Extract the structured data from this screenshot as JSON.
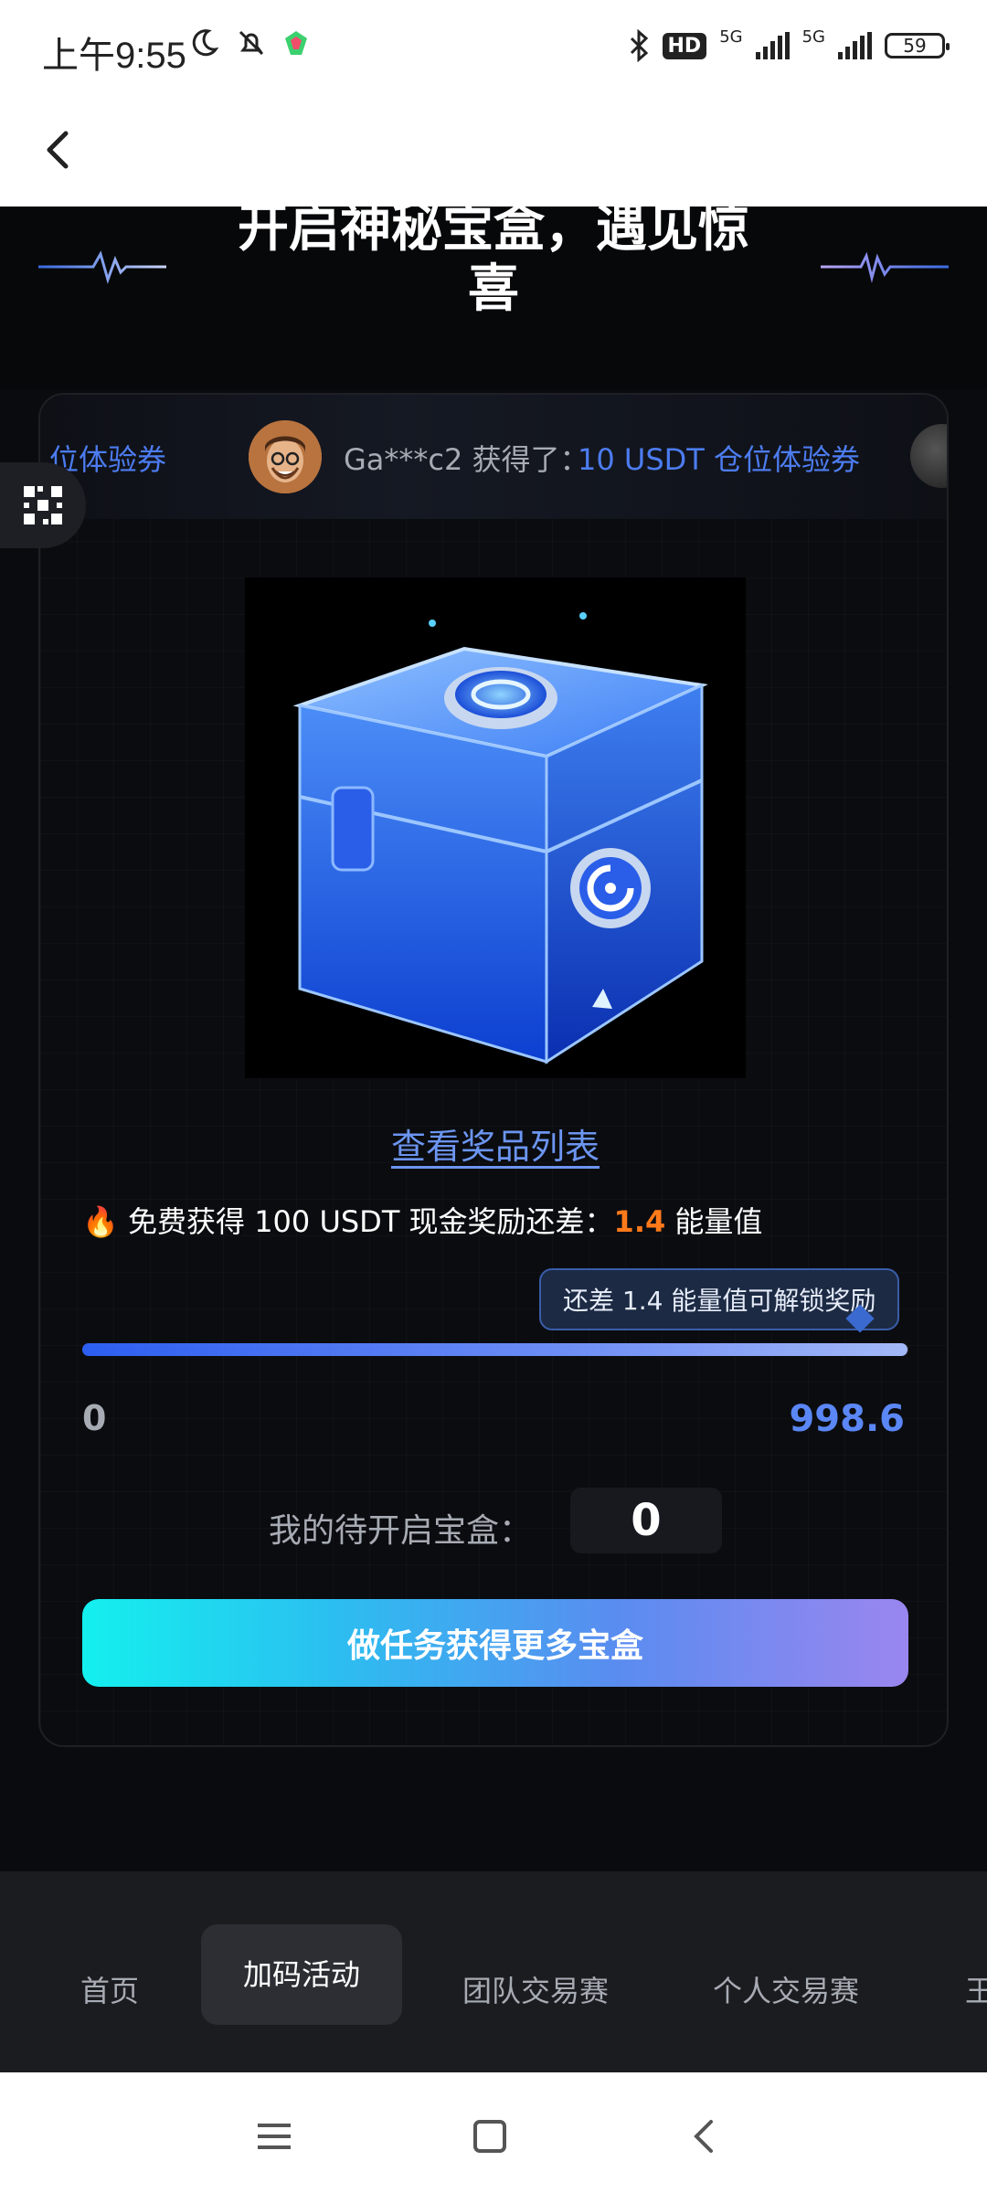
{
  "status_bar": {
    "time": "上午9:55",
    "hd_badge": "HD",
    "net_1": "5G",
    "net_2": "5G",
    "battery": "59"
  },
  "hero": {
    "title": "开启神秘宝盒，遇见惊喜"
  },
  "ticker": {
    "tail_text": "位体验券",
    "user_text": "Ga***c2 获得了：",
    "prize_text": "10 USDT 仓位体验券"
  },
  "prize_link": "查看奖品列表",
  "info": {
    "prefix": "免费获得 100 USDT 现金奖励还差：",
    "value": "1.4",
    "suffix": "能量值"
  },
  "tooltip": "还差 1.4 能量值可解锁奖励",
  "progress": {
    "min": "0",
    "max": "998.6",
    "fraction": 0.999
  },
  "pending": {
    "label": "我的待开启宝盒：",
    "value": "0"
  },
  "cta_label": "做任务获得更多宝盒",
  "tabs": [
    "首页",
    "加码活动",
    "团队交易赛",
    "个人交易赛",
    "王"
  ],
  "colors": {
    "accent_blue": "#4c7cf0",
    "highlight_orange": "#ff7a1a",
    "cta_start": "#14f0ee",
    "cta_end": "#9a86ef"
  }
}
